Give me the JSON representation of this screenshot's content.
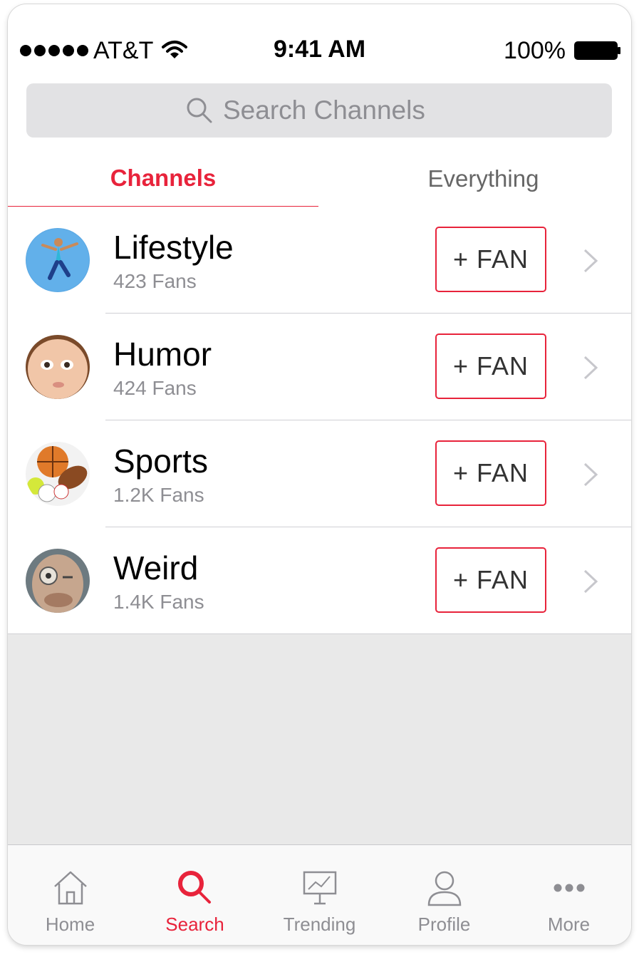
{
  "status_bar": {
    "carrier": "AT&T",
    "time": "9:41 AM",
    "battery": "100%"
  },
  "search": {
    "placeholder": "Search Channels"
  },
  "tabs": [
    {
      "label": "Channels",
      "active": true
    },
    {
      "label": "Everything",
      "active": false
    }
  ],
  "channels": [
    {
      "name": "Lifestyle",
      "fans": "423 Fans",
      "button": "+ FAN"
    },
    {
      "name": "Humor",
      "fans": "424 Fans",
      "button": "+ FAN"
    },
    {
      "name": "Sports",
      "fans": "1.2K Fans",
      "button": "+ FAN"
    },
    {
      "name": "Weird",
      "fans": "1.4K Fans",
      "button": "+ FAN"
    }
  ],
  "tab_bar": [
    {
      "label": "Home",
      "icon": "home-icon",
      "active": false
    },
    {
      "label": "Search",
      "icon": "search-icon",
      "active": true
    },
    {
      "label": "Trending",
      "icon": "trending-icon",
      "active": false
    },
    {
      "label": "Profile",
      "icon": "profile-icon",
      "active": false
    },
    {
      "label": "More",
      "icon": "more-icon",
      "active": false
    }
  ],
  "colors": {
    "accent": "#e8233b",
    "secondary_text": "#8e8e93",
    "background": "#e9e9e9"
  }
}
